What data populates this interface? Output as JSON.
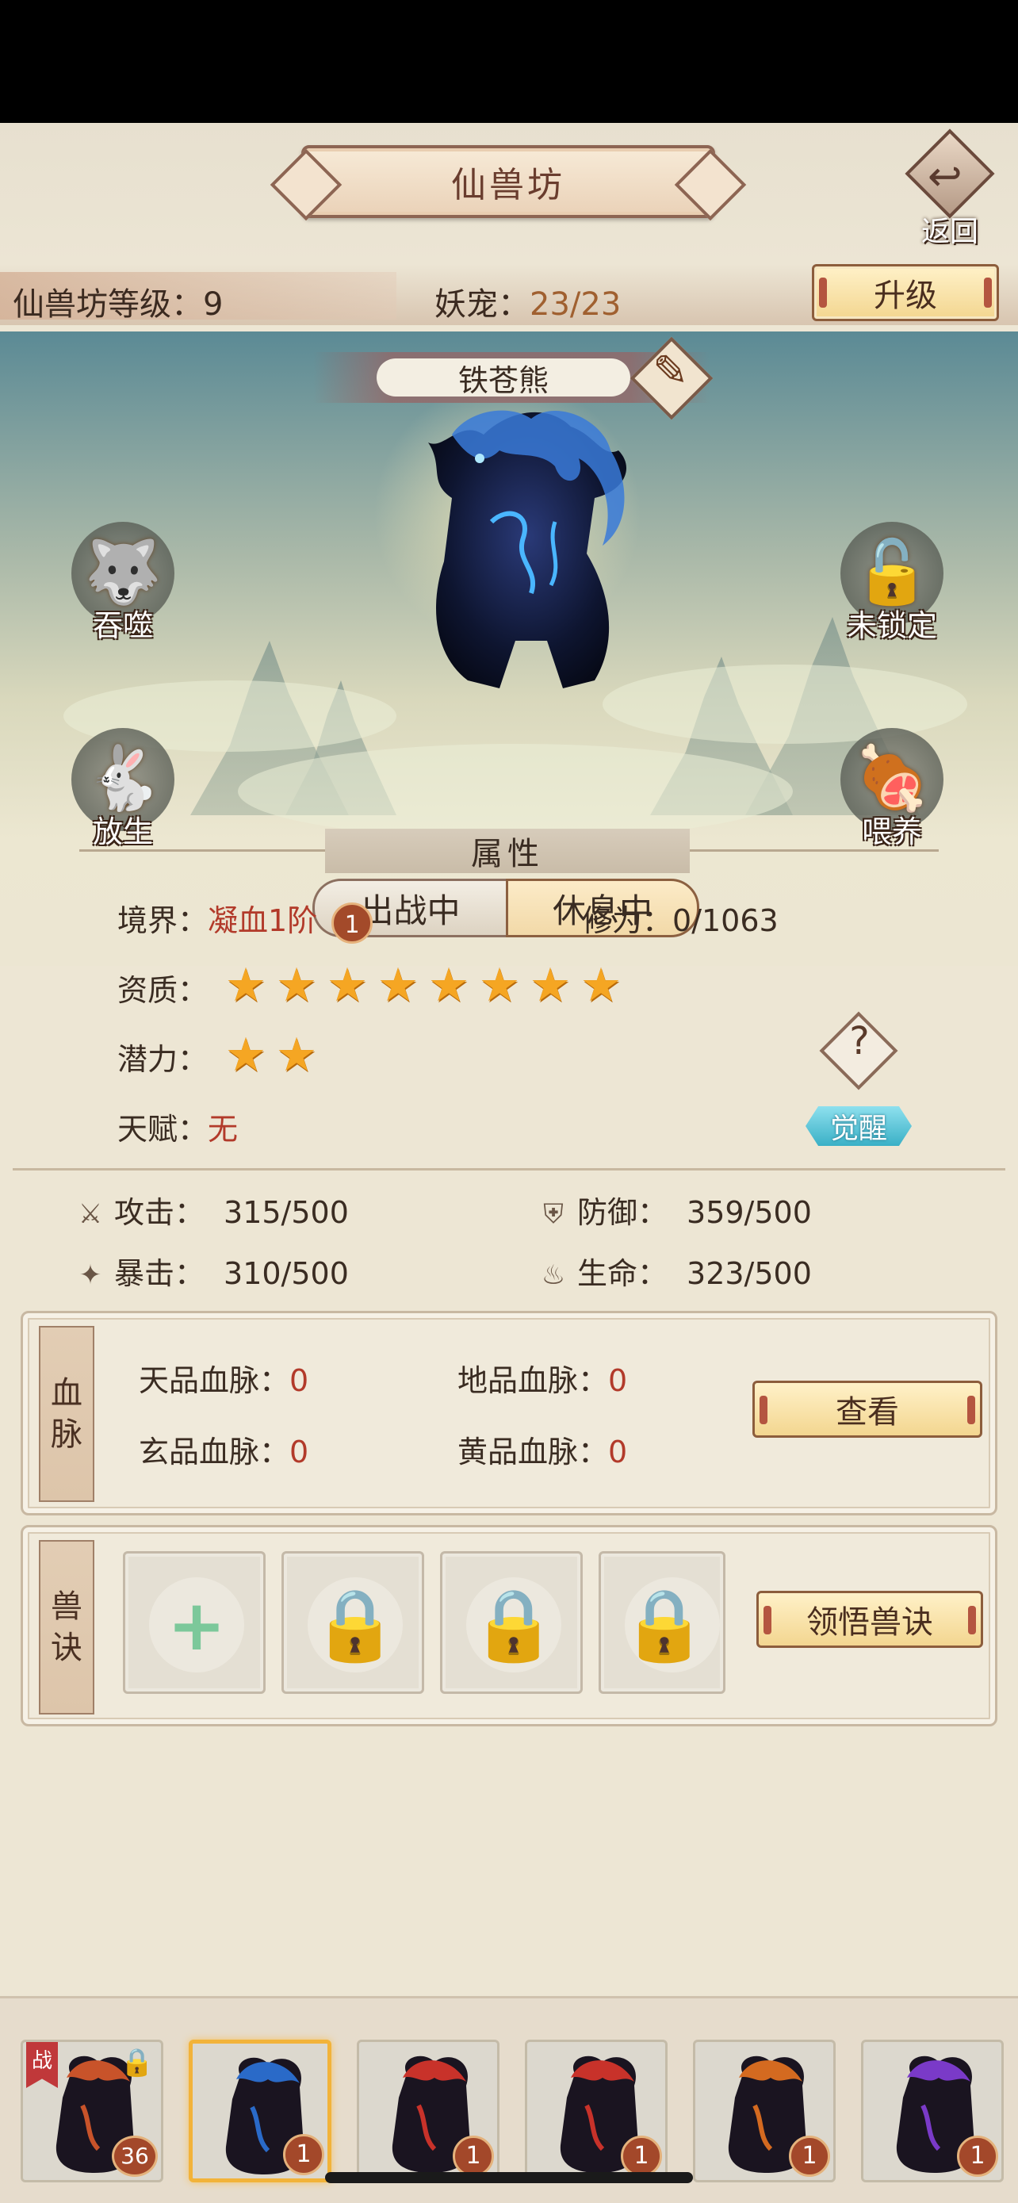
{
  "header": {
    "title": "仙兽坊",
    "back_label": "返回",
    "level_label": "仙兽坊等级：9",
    "pet_label": "妖宠：",
    "pet_count": "23/23",
    "upgrade_label": "升级"
  },
  "beast": {
    "name": "铁苍熊",
    "actions": {
      "devour": "吞噬",
      "lock": "未锁定",
      "release": "放生",
      "feed": "喂养"
    },
    "state": {
      "fight": "出战中",
      "rest": "休息中",
      "active": "rest"
    }
  },
  "attributes": {
    "title": "属性",
    "realm_label": "境界：",
    "realm_value": "凝血1阶",
    "realm_badge": "1",
    "cultivation_label": "修为：",
    "cultivation_value": "0/1063",
    "aptitude_label": "资质：",
    "aptitude_stars": 8,
    "potential_label": "潜力：",
    "potential_stars": 2,
    "talent_label": "天赋：",
    "talent_value": "无",
    "help_label": "?",
    "awaken_label": "觉醒"
  },
  "stats": {
    "attack_label": "攻击：",
    "attack_value": "315/500",
    "defense_label": "防御：",
    "defense_value": "359/500",
    "crit_label": "暴击：",
    "crit_value": "310/500",
    "life_label": "生命：",
    "life_value": "323/500"
  },
  "bloodline": {
    "tab_1": "血",
    "tab_2": "脉",
    "heaven_label": "天品血脉：",
    "heaven_value": "0",
    "earth_label": "地品血脉：",
    "earth_value": "0",
    "mystic_label": "玄品血脉：",
    "mystic_value": "0",
    "yellow_label": "黄品血脉：",
    "yellow_value": "0",
    "view_label": "查看"
  },
  "skills": {
    "tab_1": "兽",
    "tab_2": "诀",
    "learn_label": "领悟兽诀"
  },
  "roster": [
    {
      "name": "phoenix",
      "level": "36",
      "war_flag": "战",
      "color": "#c8532a"
    },
    {
      "name": "blue-bear",
      "level": "1",
      "color": "#2a6ac8"
    },
    {
      "name": "flame-bear-1",
      "level": "1",
      "color": "#c8322a"
    },
    {
      "name": "flame-bear-2",
      "level": "1",
      "color": "#c8322a"
    },
    {
      "name": "magma-golem",
      "level": "1",
      "color": "#d46a20"
    },
    {
      "name": "purple-bear",
      "level": "1",
      "color": "#7a3ac8"
    }
  ],
  "colors": {
    "accent_red": "#b23a2a",
    "badge": "#a3482a",
    "star": "#f5a623",
    "awaken": "#3ab0c6"
  }
}
